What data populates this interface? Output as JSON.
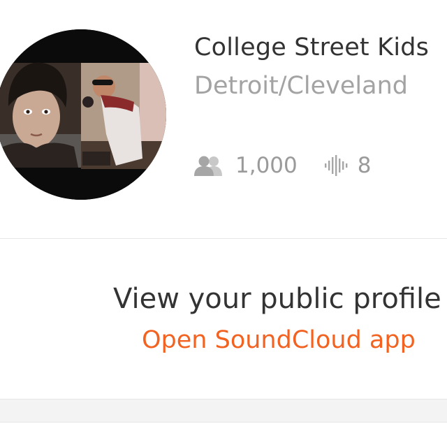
{
  "profile": {
    "name": "College Street Kids",
    "location": "Detroit/Cleveland",
    "avatar_icon": "profile-photo-collage",
    "followers_icon": "followers-icon",
    "followers_count": "1,000",
    "tracks_icon": "waveform-icon",
    "tracks_count": "8"
  },
  "actions": {
    "view_profile_label": "View your public profile",
    "open_app_label": "Open SoundCloud app"
  },
  "colors": {
    "accent": "#f26322",
    "text_primary": "#333333",
    "text_secondary": "#a3a3a3"
  }
}
